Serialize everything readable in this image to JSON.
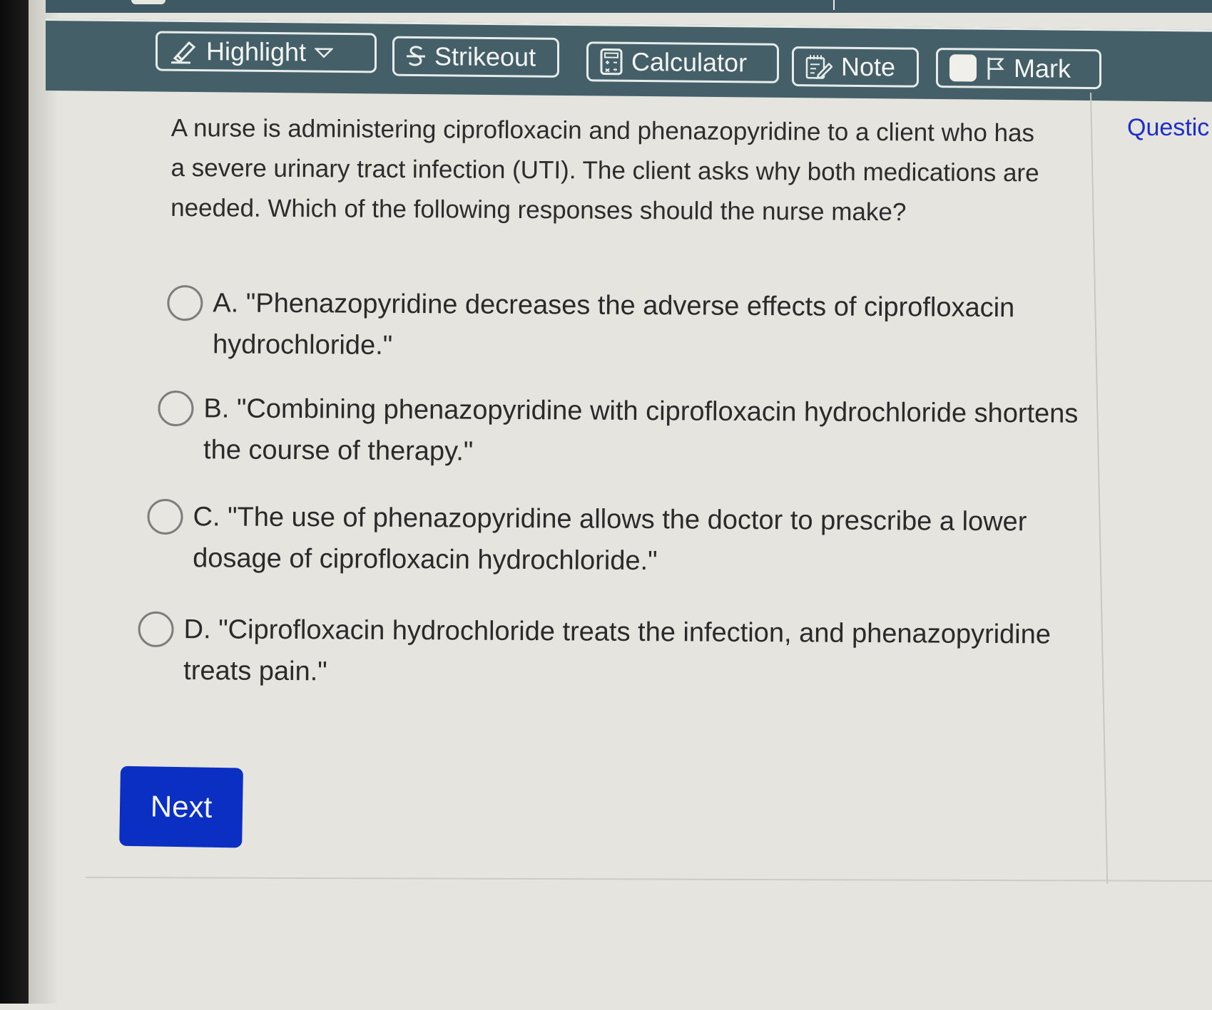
{
  "toolbar": {
    "highlight_label": "Highlight",
    "strikeout_label": "Strikeout",
    "calculator_label": "Calculator",
    "note_label": "Note",
    "mark_label": "Mark"
  },
  "side_panel": {
    "link_label": "Questic"
  },
  "question": {
    "stem": "A nurse is administering ciprofloxacin and phenazopyridine to a client who has a severe urinary tract infection (UTI). The client asks why both medications are needed. Which of the following responses should the nurse make?",
    "options": [
      {
        "letter": "A",
        "text": "A. \"Phenazopyridine decreases the adverse effects of ciprofloxacin hydrochloride.\"",
        "selected": false
      },
      {
        "letter": "B",
        "text": "B. \"Combining phenazopyridine with ciprofloxacin hydrochloride shortens the course of therapy.\"",
        "selected": false
      },
      {
        "letter": "C",
        "text": "C. \"The use of phenazopyridine allows the doctor to prescribe a lower dosage of ciprofloxacin hydrochloride.\"",
        "selected": false
      },
      {
        "letter": "D",
        "text": "D. \"Ciprofloxacin hydrochloride treats the infection, and phenazopyridine treats pain.\"",
        "selected": false
      }
    ]
  },
  "footer": {
    "next_label": "Next"
  },
  "colors": {
    "toolbar_bg": "#455f69",
    "next_button": "#0a2fc2",
    "link": "#1d2fc7"
  }
}
